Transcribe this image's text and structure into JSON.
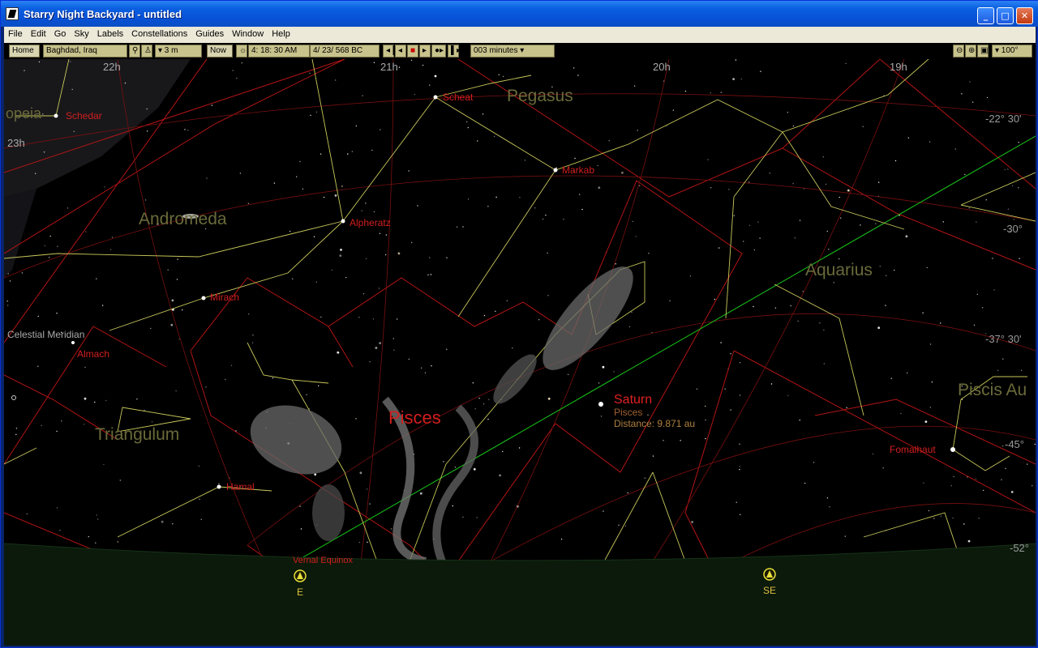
{
  "window": {
    "title": "Starry Night Backyard - untitled"
  },
  "titlebar_buttons": {
    "minimize": "_",
    "maximize": "□",
    "close": "✕"
  },
  "menu": [
    "File",
    "Edit",
    "Go",
    "Sky",
    "Labels",
    "Constellations",
    "Guides",
    "Window",
    "Help"
  ],
  "toolbar": {
    "home_label": "Home",
    "location": "Baghdad, Iraq",
    "elevation": "▾ 3 m",
    "now_label": "Now",
    "time": "4: 18: 30 AM",
    "date": "4/ 23/   568 BC",
    "time_step": "003 minutes ▾",
    "fov": "▾ 100°"
  },
  "sky": {
    "ra_labels": [
      "22h",
      "21h",
      "20h",
      "19h",
      "23h"
    ],
    "dec_labels": [
      "-22° 30'",
      "-30°",
      "-37° 30'",
      "-45°",
      "-52°"
    ],
    "constellations": [
      "Pegasus",
      "Andromeda",
      "Aquarius",
      "Pisces",
      "Triangulum",
      "Piscis Au",
      "opeia"
    ],
    "stars": [
      "Schedar",
      "Scheat",
      "Markab",
      "Alpheratz",
      "Mirach",
      "Almach",
      "Hamal",
      "Fomalhaut"
    ],
    "guides": [
      "Celestial Meridian",
      "Vernal Equinox"
    ],
    "saturn": {
      "name": "Saturn",
      "constellation": "Pisces",
      "distance": "Distance: 9.871 au"
    },
    "compass": [
      "E",
      "SE"
    ]
  },
  "colors": {
    "horizon": "#0b1a0b",
    "boundary": "#c81e1e",
    "figure": "#c8c85a",
    "ecliptic": "#18c818",
    "label_red": "#d21e1e",
    "constellation_label": "#6a6a3a"
  }
}
